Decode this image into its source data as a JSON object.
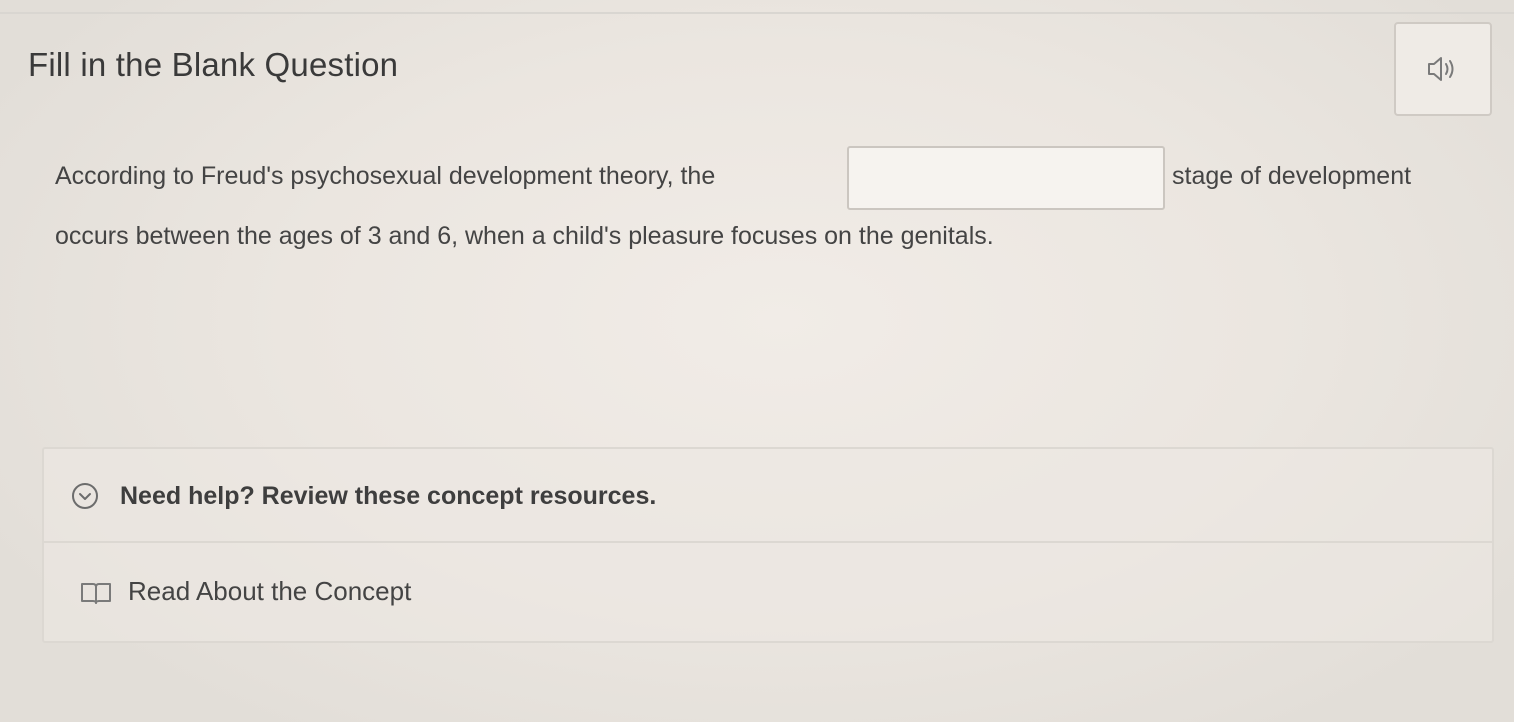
{
  "header": {
    "title": "Fill in the Blank Question",
    "audio_icon": "speaker-icon"
  },
  "question": {
    "text_before_blank": "According to Freud's psychosexual development theory, the",
    "blank_value": "",
    "text_after_blank": "stage of development",
    "text_line_2": "occurs between the ages of 3 and 6, when a child's pleasure focuses on the genitals."
  },
  "help": {
    "toggle_icon": "chevron-down-circle-icon",
    "label": "Need help? Review these concept resources.",
    "resources": [
      {
        "icon": "book-icon",
        "label": "Read About the Concept"
      }
    ]
  }
}
